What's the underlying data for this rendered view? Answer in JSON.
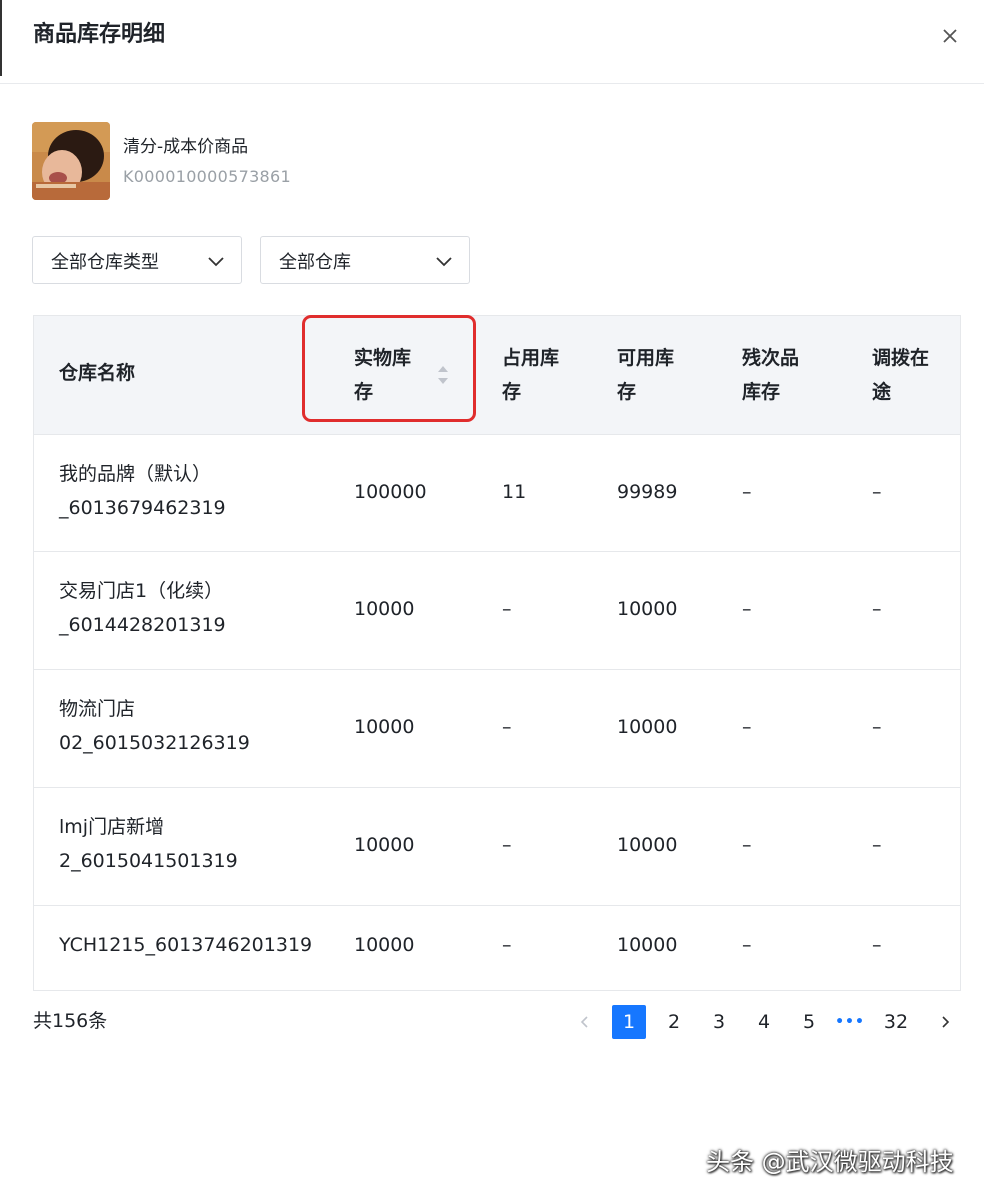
{
  "dialog": {
    "title": "商品库存明细",
    "close_icon": "close-icon"
  },
  "product": {
    "name": "清分-成本价商品",
    "code": "K000010000573861"
  },
  "filters": {
    "warehouse_type": "全部仓库类型",
    "warehouse": "全部仓库"
  },
  "table": {
    "headers": {
      "name": "仓库名称",
      "physical_l1": "实物库",
      "physical_l2": "存",
      "occupied_l1": "占用库",
      "occupied_l2": "存",
      "available_l1": "可用库",
      "available_l2": "存",
      "defective_l1": "残次品",
      "defective_l2": "库存",
      "transit_l1": "调拨在",
      "transit_l2": "途"
    },
    "rows": [
      {
        "name_l1": "我的品牌（默认）",
        "name_l2": "_6013679462319",
        "physical": "100000",
        "occupied": "11",
        "available": "99989",
        "defective": "–",
        "transit": "–"
      },
      {
        "name_l1": "交易门店1（化续）",
        "name_l2": "_6014428201319",
        "physical": "10000",
        "occupied": "–",
        "available": "10000",
        "defective": "–",
        "transit": "–"
      },
      {
        "name_l1": "物流门店",
        "name_l2": "02_6015032126319",
        "physical": "10000",
        "occupied": "–",
        "available": "10000",
        "defective": "–",
        "transit": "–"
      },
      {
        "name_l1": "lmj门店新增",
        "name_l2": "2_6015041501319",
        "physical": "10000",
        "occupied": "–",
        "available": "10000",
        "defective": "–",
        "transit": "–"
      },
      {
        "name_l1": "YCH1215_6013746201319",
        "name_l2": "",
        "physical": "10000",
        "occupied": "–",
        "available": "10000",
        "defective": "–",
        "transit": "–"
      }
    ]
  },
  "pagination": {
    "total": "共156条",
    "pages": [
      "1",
      "2",
      "3",
      "4",
      "5"
    ],
    "ellipsis": "•••",
    "last": "32",
    "current": "1"
  },
  "watermark": "头条 @武汉微驱动科技",
  "colors": {
    "accent": "#1677ff",
    "highlight": "#e02d2d",
    "header_bg": "#f3f5f8"
  }
}
